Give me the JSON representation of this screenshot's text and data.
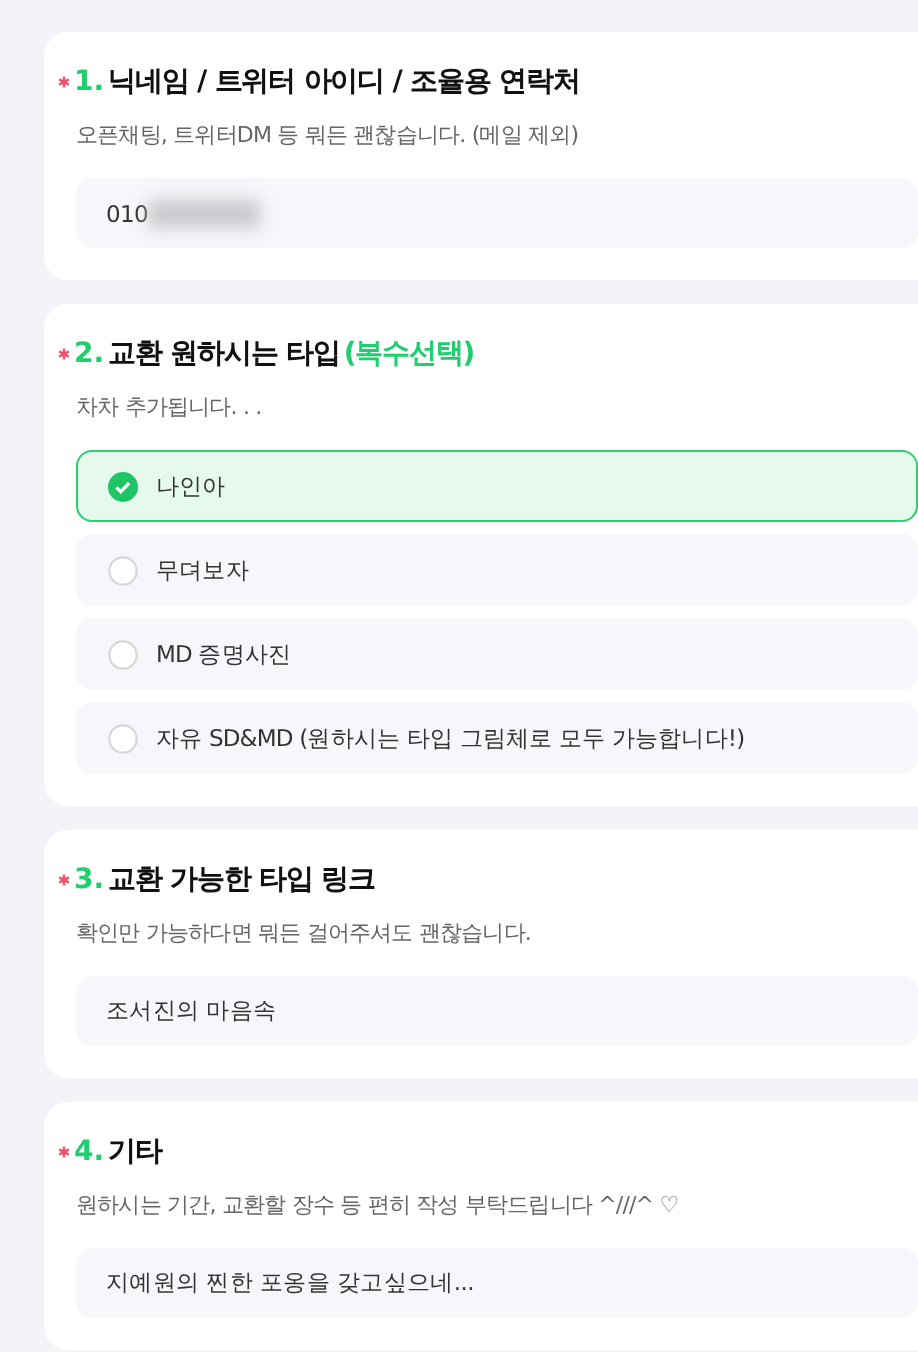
{
  "questions": [
    {
      "kind": "text",
      "required": true,
      "number": "1.",
      "title": "닉네임 / 트위터 아이디 / 조율용 연락처",
      "description": "오픈채팅, 트위터DM 등 뭐든 괜찮습니다. (메일 제외)",
      "value": "010",
      "redacted": true
    },
    {
      "kind": "choice",
      "required": true,
      "number": "2.",
      "title": "교환 원하시는 타입",
      "highlight": "(복수선택)",
      "description": "차차 추가됩니다. . .",
      "options": [
        {
          "label": "나인아",
          "selected": true
        },
        {
          "label": "무뎌보자",
          "selected": false
        },
        {
          "label": "MD 증명사진",
          "selected": false
        },
        {
          "label": "자유 SD&MD (원하시는 타입 그림체로 모두 가능합니다!)",
          "selected": false
        }
      ]
    },
    {
      "kind": "text",
      "required": true,
      "number": "3.",
      "title": "교환 가능한 타입 링크",
      "description": "확인만 가능하다면 뭐든 걸어주셔도 괜찮습니다.",
      "value": "조서진의 마음속"
    },
    {
      "kind": "text",
      "required": true,
      "number": "4.",
      "title": "기타",
      "description": "원하시는 기간, 교환할 장수 등 편히 작성 부탁드립니다 ^///^ ♡",
      "value": "지예원의 찐한 포옹을 갖고싶으네..."
    }
  ]
}
